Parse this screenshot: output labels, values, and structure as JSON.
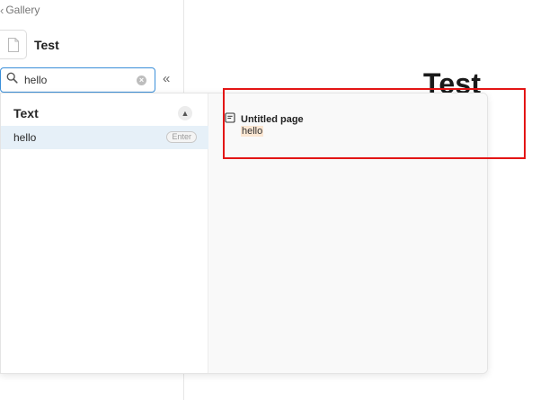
{
  "sidebar": {
    "back_label": "Gallery",
    "page_name": "Test",
    "search": {
      "value": "hello",
      "placeholder": ""
    }
  },
  "main": {
    "title": "Test"
  },
  "search_results": {
    "group_label": "Text",
    "items": [
      {
        "label": "hello",
        "shortcut": "Enter"
      }
    ]
  },
  "preview": {
    "page_title": "Untitled page",
    "snippet": "hello",
    "highlight_color": "#fbe6d2"
  },
  "annotation": {
    "color": "#e31515"
  },
  "accent_color": "#3b8fd9"
}
